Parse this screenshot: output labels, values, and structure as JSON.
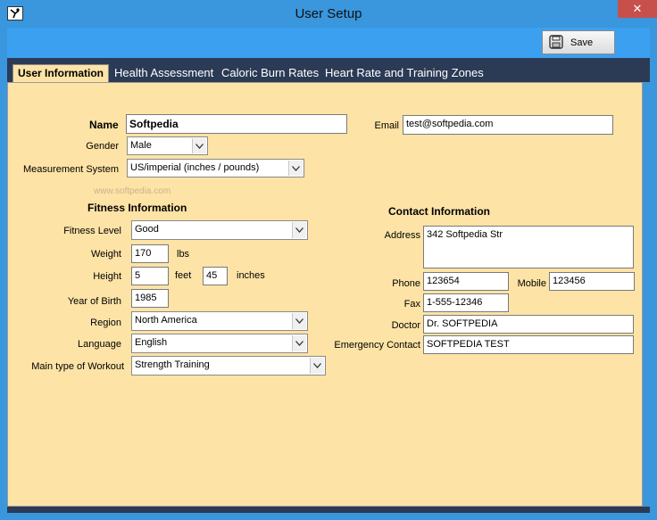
{
  "window": {
    "title": "User Setup",
    "close_symbol": "✕"
  },
  "toolbar": {
    "save_label": "Save"
  },
  "tabs": [
    {
      "label": "User Information"
    },
    {
      "label": "Health Assessment"
    },
    {
      "label": "Caloric Burn Rates"
    },
    {
      "label": "Heart Rate and Training Zones"
    }
  ],
  "user": {
    "name_label": "Name",
    "name_value": "Softpedia",
    "gender_label": "Gender",
    "gender_value": "Male",
    "measurement_label": "Measurement System",
    "measurement_value": "US/imperial (inches / pounds)",
    "email_label": "Email",
    "email_value": "test@softpedia.com"
  },
  "fitness": {
    "header": "Fitness Information",
    "level_label": "Fitness Level",
    "level_value": "Good",
    "weight_label": "Weight",
    "weight_value": "170",
    "weight_unit": "lbs",
    "height_label": "Height",
    "height_feet": "5",
    "feet_unit": "feet",
    "height_inches": "45",
    "inches_unit": "inches",
    "yob_label": "Year of Birth",
    "yob_value": "1985",
    "region_label": "Region",
    "region_value": "North America",
    "language_label": "Language",
    "language_value": "English",
    "workout_label": "Main type of Workout",
    "workout_value": "Strength Training"
  },
  "contact": {
    "header": "Contact Information",
    "address_label": "Address",
    "address_value": "342 Softpedia Str",
    "phone_label": "Phone",
    "phone_value": "123654",
    "mobile_label": "Mobile",
    "mobile_value": "123456",
    "fax_label": "Fax",
    "fax_value": "1-555-12346",
    "doctor_label": "Doctor",
    "doctor_value": "Dr. SOFTPEDIA",
    "emergency_label": "Emergency Contact",
    "emergency_value": "SOFTPEDIA TEST"
  },
  "watermark": "www.softpedia.com",
  "colors": {
    "accent": "#3a96dd",
    "panel": "#fde3a6",
    "tabbar": "#2b3b55",
    "close": "#c7504c"
  }
}
